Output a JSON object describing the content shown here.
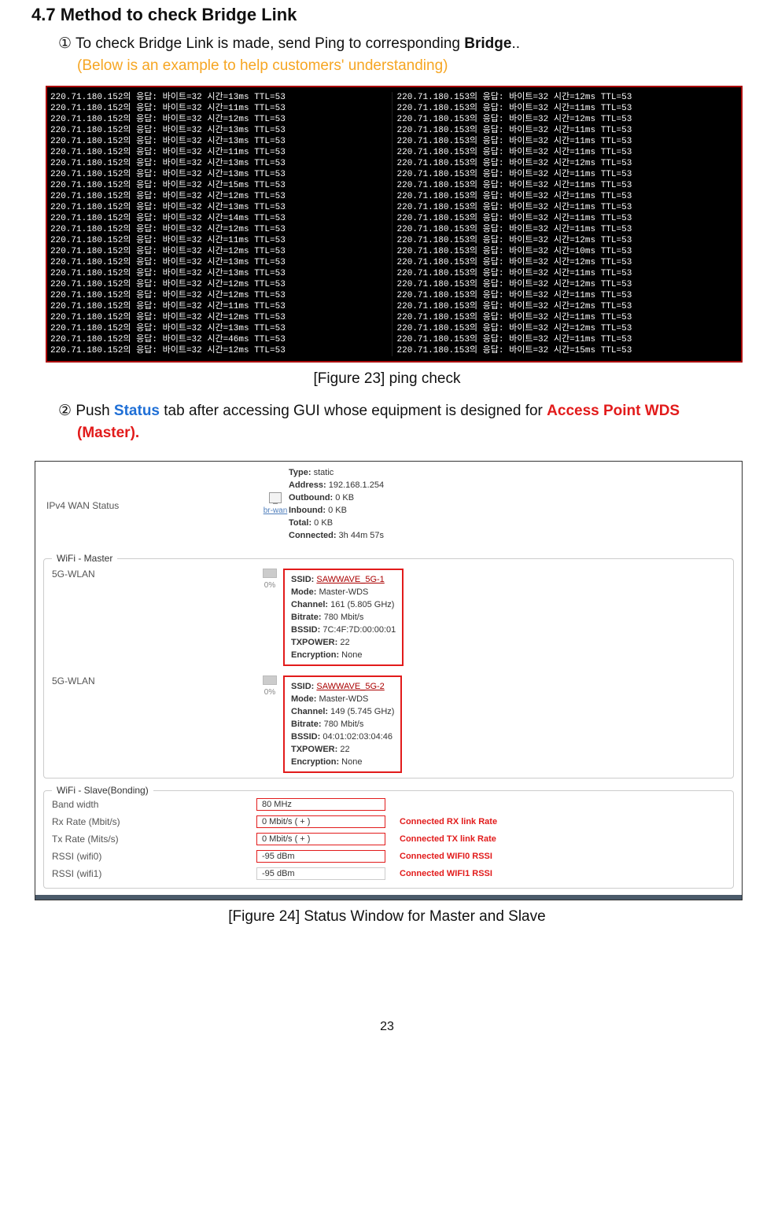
{
  "section": {
    "number": "4.7",
    "title": "Method to check Bridge Link",
    "step1_marker": "①",
    "step1_text_a": " To check Bridge Link is made, send Ping to corresponding ",
    "step1_strong": "Bridge",
    "step1_text_b": "..",
    "step1_hint": "(Below is an example to help customers' understanding)",
    "step2_marker": "②",
    "step2_text_a": " Push ",
    "step2_status": "Status",
    "step2_text_b": " tab after accessing GUI whose equipment is designed for ",
    "step2_ap": "Access Point WDS",
    "step2_master": "(Master)."
  },
  "figure23_caption": "[Figure 23] ping check",
  "figure24_caption": "[Figure 24] Status Window for Master and Slave",
  "page_number": "23",
  "ping_left": [
    "220.71.180.152의 응답: 바이트=32 시간=13ms TTL=53",
    "220.71.180.152의 응답: 바이트=32 시간=11ms TTL=53",
    "220.71.180.152의 응답: 바이트=32 시간=12ms TTL=53",
    "220.71.180.152의 응답: 바이트=32 시간=13ms TTL=53",
    "220.71.180.152의 응답: 바이트=32 시간=13ms TTL=53",
    "220.71.180.152의 응답: 바이트=32 시간=11ms TTL=53",
    "220.71.180.152의 응답: 바이트=32 시간=13ms TTL=53",
    "220.71.180.152의 응답: 바이트=32 시간=13ms TTL=53",
    "220.71.180.152의 응답: 바이트=32 시간=15ms TTL=53",
    "220.71.180.152의 응답: 바이트=32 시간=12ms TTL=53",
    "220.71.180.152의 응답: 바이트=32 시간=13ms TTL=53",
    "220.71.180.152의 응답: 바이트=32 시간=14ms TTL=53",
    "220.71.180.152의 응답: 바이트=32 시간=12ms TTL=53",
    "220.71.180.152의 응답: 바이트=32 시간=11ms TTL=53",
    "220.71.180.152의 응답: 바이트=32 시간=12ms TTL=53",
    "220.71.180.152의 응답: 바이트=32 시간=13ms TTL=53",
    "220.71.180.152의 응답: 바이트=32 시간=13ms TTL=53",
    "220.71.180.152의 응답: 바이트=32 시간=12ms TTL=53",
    "220.71.180.152의 응답: 바이트=32 시간=12ms TTL=53",
    "220.71.180.152의 응답: 바이트=32 시간=11ms TTL=53",
    "220.71.180.152의 응답: 바이트=32 시간=12ms TTL=53",
    "220.71.180.152의 응답: 바이트=32 시간=13ms TTL=53",
    "220.71.180.152의 응답: 바이트=32 시간=46ms TTL=53",
    "220.71.180.152의 응답: 바이트=32 시간=12ms TTL=53"
  ],
  "ping_right": [
    "220.71.180.153의 응답: 바이트=32 시간=12ms TTL=53",
    "220.71.180.153의 응답: 바이트=32 시간=11ms TTL=53",
    "220.71.180.153의 응답: 바이트=32 시간=12ms TTL=53",
    "220.71.180.153의 응답: 바이트=32 시간=11ms TTL=53",
    "220.71.180.153의 응답: 바이트=32 시간=11ms TTL=53",
    "220.71.180.153의 응답: 바이트=32 시간=11ms TTL=53",
    "220.71.180.153의 응답: 바이트=32 시간=12ms TTL=53",
    "220.71.180.153의 응답: 바이트=32 시간=11ms TTL=53",
    "220.71.180.153의 응답: 바이트=32 시간=11ms TTL=53",
    "220.71.180.153의 응답: 바이트=32 시간=11ms TTL=53",
    "220.71.180.153의 응답: 바이트=32 시간=11ms TTL=53",
    "220.71.180.153의 응답: 바이트=32 시간=11ms TTL=53",
    "220.71.180.153의 응답: 바이트=32 시간=11ms TTL=53",
    "220.71.180.153의 응답: 바이트=32 시간=12ms TTL=53",
    "220.71.180.153의 응답: 바이트=32 시간=10ms TTL=53",
    "220.71.180.153의 응답: 바이트=32 시간=12ms TTL=53",
    "220.71.180.153의 응답: 바이트=32 시간=11ms TTL=53",
    "220.71.180.153의 응답: 바이트=32 시간=12ms TTL=53",
    "220.71.180.153의 응답: 바이트=32 시간=11ms TTL=53",
    "220.71.180.153의 응답: 바이트=32 시간=12ms TTL=53",
    "220.71.180.153의 응답: 바이트=32 시간=11ms TTL=53",
    "220.71.180.153의 응답: 바이트=32 시간=12ms TTL=53",
    "220.71.180.153의 응답: 바이트=32 시간=11ms TTL=53",
    "220.71.180.153의 응답: 바이트=32 시간=15ms TTL=53"
  ],
  "gui": {
    "wan_title": "IPv4 WAN Status",
    "wan_iface_link": "br-wan",
    "wan": {
      "type_l": "Type:",
      "type_v": " static",
      "addr_l": "Address:",
      "addr_v": " 192.168.1.254",
      "out_l": "Outbound:",
      "out_v": " 0 KB",
      "in_l": "Inbound:",
      "in_v": " 0 KB",
      "tot_l": "Total:",
      "tot_v": " 0 KB",
      "con_l": "Connected:",
      "con_v": " 3h 44m 57s"
    },
    "master_legend": "WiFi - Master",
    "wlan_label": "5G-WLAN",
    "pct": "0%",
    "wlan1": {
      "ssid_l": "SSID:",
      "ssid_v": "SAWWAVE_5G-1",
      "mode_l": "Mode:",
      "mode_v": " Master-WDS",
      "ch_l": "Channel:",
      "ch_v": " 161 (5.805 GHz)",
      "br_l": "Bitrate:",
      "br_v": " 780 Mbit/s",
      "bss_l": "BSSID:",
      "bss_v": " 7C:4F:7D:00:00:01",
      "txp_l": "TXPOWER:",
      "txp_v": " 22",
      "enc_l": "Encryption:",
      "enc_v": " None"
    },
    "wlan2": {
      "ssid_l": "SSID:",
      "ssid_v": "SAWWAVE_5G-2",
      "mode_l": "Mode:",
      "mode_v": " Master-WDS",
      "ch_l": "Channel:",
      "ch_v": " 149 (5.745 GHz)",
      "br_l": "Bitrate:",
      "br_v": " 780 Mbit/s",
      "bss_l": "BSSID:",
      "bss_v": " 04:01:02:03:04:46",
      "txp_l": "TXPOWER:",
      "txp_v": " 22",
      "enc_l": "Encryption:",
      "enc_v": " None"
    },
    "slave_legend": "WiFi - Slave(Bonding)",
    "slave_rows": {
      "bw_l": "Band width",
      "bw_v": "80 MHz",
      "rx_l": "Rx Rate (Mbit/s)",
      "rx_v": "0 Mbit/s ( + )",
      "rx_note": "Connected RX link Rate",
      "tx_l": "Tx Rate (Mits/s)",
      "tx_v": "0 Mbit/s ( + )",
      "tx_note": "Connected TX link Rate",
      "r0_l": "RSSI (wifi0)",
      "r0_v": "-95 dBm",
      "r0_note": "Connected WIFI0 RSSI",
      "r1_l": "RSSI (wifi1)",
      "r1_v": "-95 dBm",
      "r1_note": "Connected WIFI1 RSSI"
    }
  }
}
